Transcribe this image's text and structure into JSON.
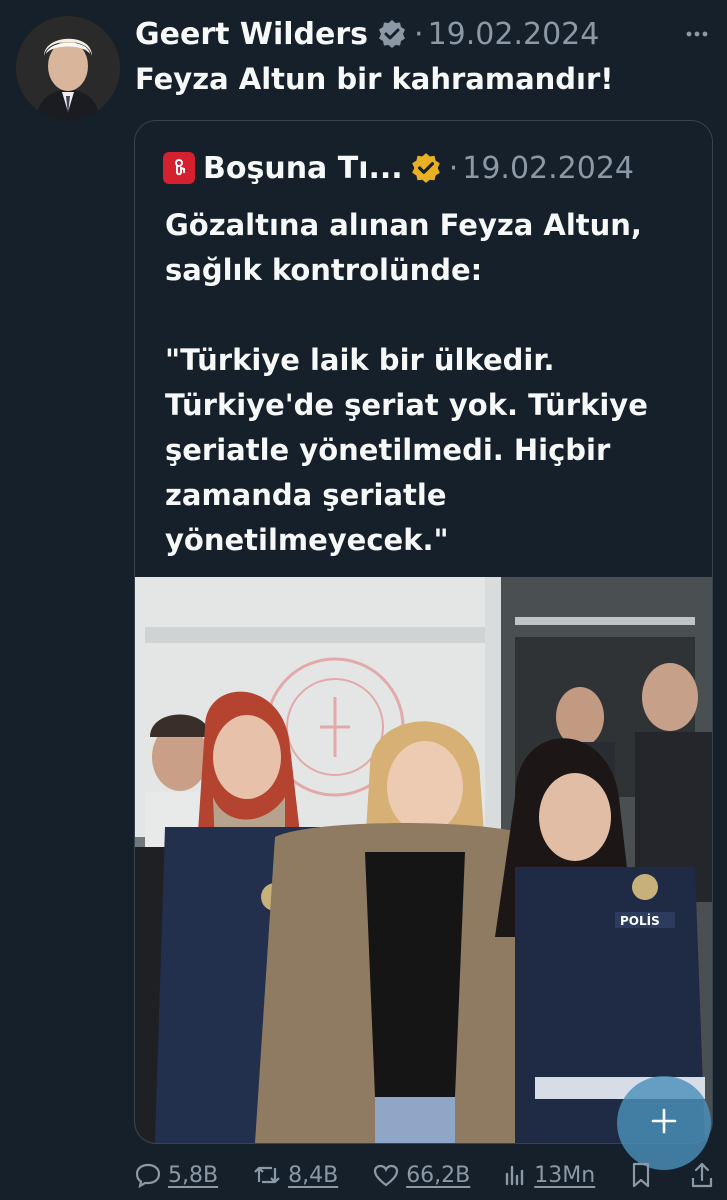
{
  "tweet": {
    "author_name": "Geert Wilders",
    "date": "19.02.2024",
    "text": "Feyza Altun bir kahramandır!"
  },
  "quote": {
    "author_name": "Boşuna Tı...",
    "date": "19.02.2024",
    "paragraph1": "Gözaltına alınan Feyza Altun, sağlık kontrolünde:",
    "paragraph2": "\"Türkiye laik bir ülkedir. Türkiye'de şeriat yok. Türkiye şeriatle yönetilmedi. Hiçbir zamanda şeriatle yönetilmeyecek.\"",
    "image_badge_text": "POLİS"
  },
  "actions": {
    "replies": "5,8B",
    "retweets": "8,4B",
    "likes": "66,2B",
    "views": "13Mn"
  },
  "colors": {
    "background": "#15202b",
    "text_primary": "#f7f9f9",
    "text_secondary": "#8b98a5",
    "verified_blue": "#8b98a5",
    "verified_gold": "#e8b124",
    "fab": "#4a90ba"
  },
  "icons": {
    "verified": "verified-badge-icon",
    "gold_verified": "gold-verified-badge-icon",
    "more": "more-icon",
    "reply": "reply-icon",
    "retweet": "retweet-icon",
    "like": "heart-icon",
    "views": "views-icon",
    "bookmark": "bookmark-icon",
    "share": "share-icon",
    "compose": "plus-icon"
  }
}
